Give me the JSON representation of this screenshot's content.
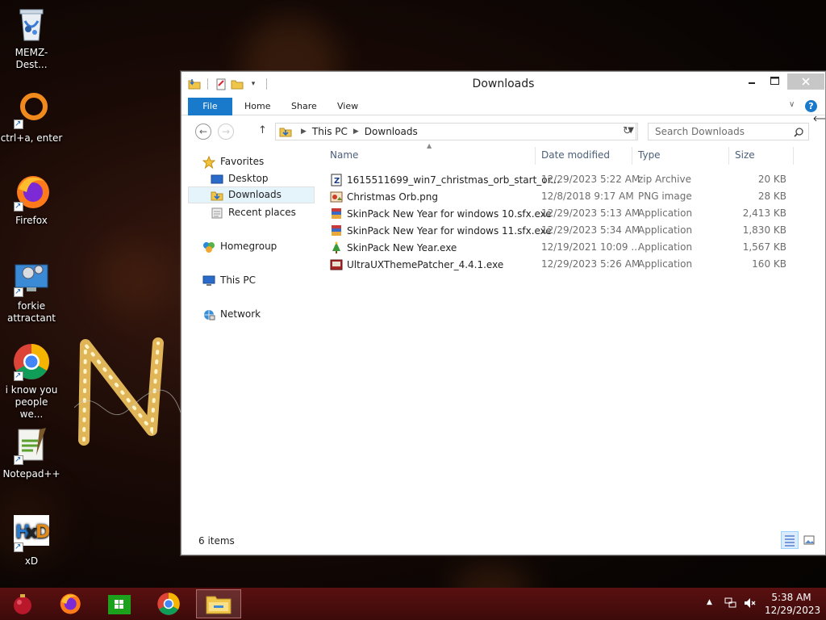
{
  "desktop": {
    "icons": [
      {
        "label": "MEMZ-Dest...",
        "icon": "recycle-bin-icon"
      },
      {
        "label": "ctrl+a, enter",
        "icon": "orange-ring-icon"
      },
      {
        "label": "Firefox",
        "icon": "firefox-icon"
      },
      {
        "label": "forkie attractant",
        "icon": "computer-gear-icon"
      },
      {
        "label": "i know you people we...",
        "icon": "chrome-icon"
      },
      {
        "label": "Notepad++",
        "icon": "notepadpp-icon"
      },
      {
        "label": "xD",
        "icon": "hxd-icon"
      }
    ]
  },
  "window": {
    "title": "Downloads",
    "ribbon": {
      "file": "File",
      "home": "Home",
      "share": "Share",
      "view": "View"
    },
    "address": {
      "this_pc": "This PC",
      "current": "Downloads"
    },
    "search": {
      "placeholder": "Search Downloads"
    },
    "nav": {
      "favorites": "Favorites",
      "desktop": "Desktop",
      "downloads": "Downloads",
      "recent": "Recent places",
      "homegroup": "Homegroup",
      "this_pc": "This PC",
      "network": "Network"
    },
    "columns": {
      "name": "Name",
      "date": "Date modified",
      "type": "Type",
      "size": "Size"
    },
    "files": [
      {
        "name": "1615511699_win7_christmas_orb_start_or...",
        "date": "12/29/2023 5:22 AM",
        "type": "zip Archive",
        "size": "20 KB",
        "icon": "zip-icon"
      },
      {
        "name": "Christmas Orb.png",
        "date": "12/8/2018 9:17 AM",
        "type": "PNG image",
        "size": "28 KB",
        "icon": "png-image-icon"
      },
      {
        "name": "SkinPack New Year for windows 10.sfx.exe",
        "date": "12/29/2023 5:13 AM",
        "type": "Application",
        "size": "2,413 KB",
        "icon": "sfx-exe-icon"
      },
      {
        "name": "SkinPack New Year for windows 11.sfx.exe",
        "date": "12/29/2023 5:34 AM",
        "type": "Application",
        "size": "1,830 KB",
        "icon": "sfx-exe-icon"
      },
      {
        "name": "SkinPack New Year.exe",
        "date": "12/19/2021 10:09 ...",
        "type": "Application",
        "size": "1,567 KB",
        "icon": "tree-exe-icon"
      },
      {
        "name": "UltraUXThemePatcher_4.4.1.exe",
        "date": "12/29/2023 5:26 AM",
        "type": "Application",
        "size": "160 KB",
        "icon": "patcher-exe-icon"
      }
    ],
    "status": "6 items"
  },
  "taskbar": {
    "time": "5:38 AM",
    "date": "12/29/2023"
  }
}
